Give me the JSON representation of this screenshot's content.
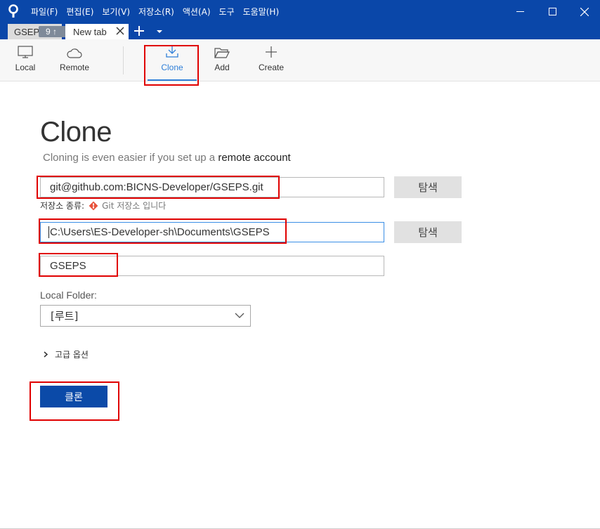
{
  "titlebar": {
    "menu": [
      "파일(F)",
      "편집(E)",
      "보기(V)",
      "저장소(R)",
      "액션(A)",
      "도구",
      "도움말(H)"
    ]
  },
  "tabs": {
    "repo_tab": "GSEP",
    "repo_badge": "9 ↑",
    "new_tab": "New tab"
  },
  "toolbar": {
    "local": "Local",
    "remote": "Remote",
    "clone": "Clone",
    "add": "Add",
    "create": "Create"
  },
  "page": {
    "title": "Clone",
    "subtitle_prefix": "Cloning is even easier if you set up a",
    "subtitle_link": "remote account"
  },
  "form": {
    "source_url": "git@github.com:BICNS-Developer/GSEPS.git",
    "browse_label": "탐색",
    "repo_type_label": "저장소 종류:",
    "repo_type_value": "Git 저장소 입니다",
    "destination_path": "C:\\Users\\ES-Developer-sh\\Documents\\GSEPS",
    "name": "GSEPS",
    "local_folder_label": "Local Folder:",
    "local_folder_value": "[루트]",
    "advanced_label": "고급 옵션",
    "clone_button": "클론"
  },
  "colors": {
    "titlebar": "#0a47a9",
    "accent": "#2f7fd8",
    "primary_button": "#0b4aa8",
    "highlight": "#e00000"
  }
}
